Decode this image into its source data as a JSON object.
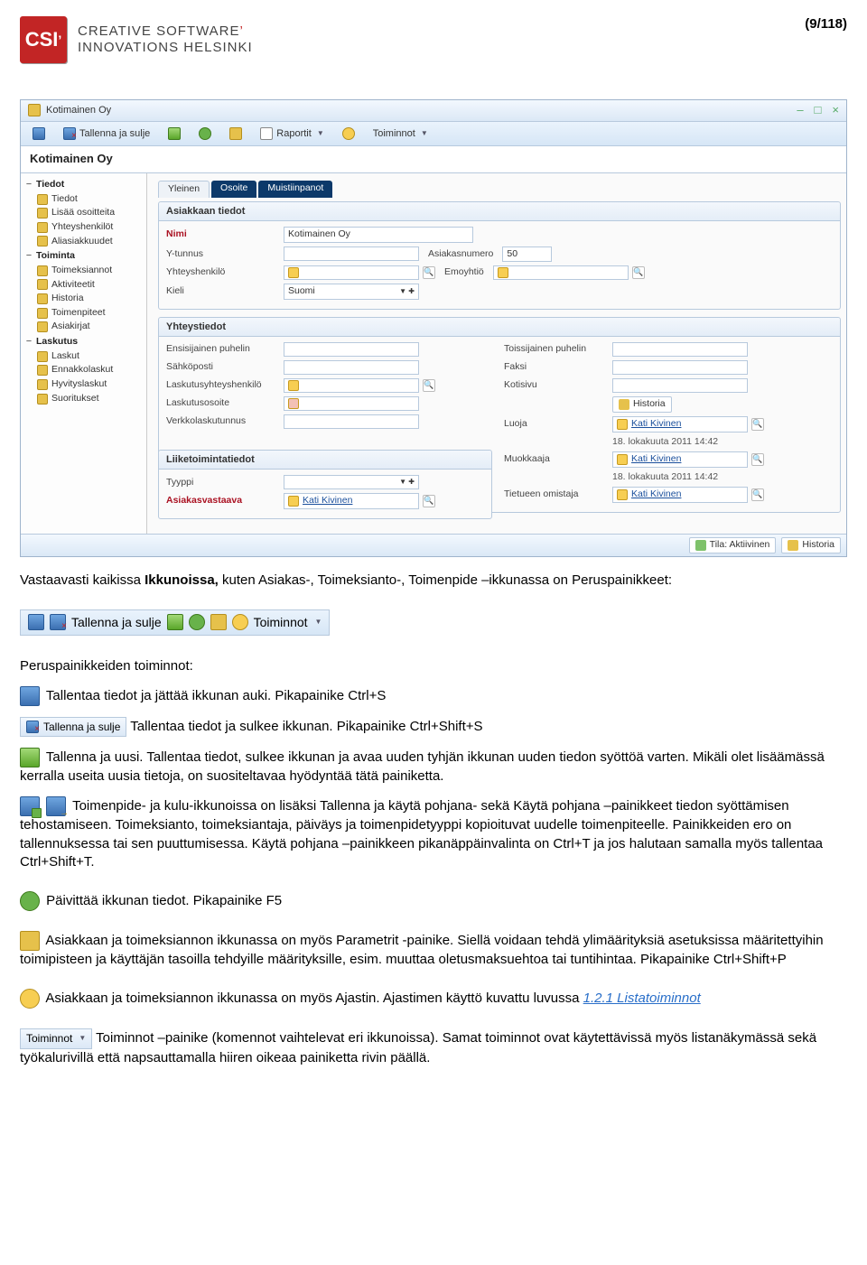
{
  "header": {
    "logo_mark": "CSI",
    "logo_line1": "CREATIVE SOFTWARE",
    "logo_line2": "INNOVATIONS HELSINKI",
    "page_indicator": "(9/118)"
  },
  "window": {
    "title": "Kotimainen Oy",
    "win_min": "–",
    "win_max": "□",
    "win_close": "×",
    "toolbar": {
      "save_close": "Tallenna ja sulje",
      "reports": "Raportit",
      "actions": "Toiminnot"
    },
    "subheader": "Kotimainen Oy",
    "tree": {
      "cat1": {
        "title": "Tiedot",
        "items": [
          "Tiedot",
          "Lisää osoitteita",
          "Yhteyshenkilöt",
          "Aliasiakkuudet"
        ]
      },
      "cat2": {
        "title": "Toiminta",
        "items": [
          "Toimeksiannot",
          "Aktiviteetit",
          "Historia",
          "Toimenpiteet",
          "Asiakirjat"
        ]
      },
      "cat3": {
        "title": "Laskutus",
        "items": [
          "Laskut",
          "Ennakkolaskut",
          "Hyvityslaskut",
          "Suoritukset"
        ]
      }
    },
    "tabs": {
      "t1": "Yleinen",
      "t2": "Osoite",
      "t3": "Muistiinpanot"
    },
    "panel1": {
      "title": "Asiakkaan tiedot",
      "name_label": "Nimi",
      "name_value": "Kotimainen Oy",
      "ytunnus_label": "Y-tunnus",
      "custno_label": "Asiakasnumero",
      "custno_value": "50",
      "contact_label": "Yhteyshenkilö",
      "parent_label": "Emoyhtiö",
      "lang_label": "Kieli",
      "lang_value": "Suomi"
    },
    "panel2": {
      "title": "Yhteystiedot",
      "phone1_label": "Ensisijainen puhelin",
      "phone2_label": "Toissijainen puhelin",
      "email_label": "Sähköposti",
      "fax_label": "Faksi",
      "billcontact_label": "Laskutusyhteyshenkilö",
      "website_label": "Kotisivu",
      "billaddr_label": "Laskutusosoite",
      "history_btn": "Historia",
      "einvoice_label": "Verkkolaskutunnus",
      "creator_label": "Luoja",
      "creator_value": "Kati Kivinen",
      "created_at": "18. lokakuuta 2011 14:42",
      "modifier_label": "Muokkaaja",
      "modifier_value": "Kati Kivinen",
      "modified_at": "18. lokakuuta 2011 14:42",
      "owner_label": "Tietueen omistaja",
      "owner_value": "Kati Kivinen"
    },
    "panel3": {
      "title": "Liiketoimintatiedot",
      "type_label": "Tyyppi",
      "resp_label": "Asiakasvastaava",
      "resp_value": "Kati Kivinen"
    },
    "status": {
      "active_label": "Tila: Aktiivinen",
      "history_label": "Historia"
    }
  },
  "doc": {
    "intro1a": "Vastaavasti kaikissa ",
    "intro1b": "Ikkunoissa,",
    "intro1c": " kuten Asiakas-, Toimeksianto-, Toimenpide –ikkunassa on Peruspainikkeet:",
    "funcs_heading": "Peruspainikkeiden toiminnot:",
    "p_save": " Tallentaa tiedot ja jättää ikkunan auki. Pikapainike Ctrl+S",
    "p_saveclose_btn": "Tallenna ja sulje",
    "p_saveclose": " Tallentaa tiedot ja sulkee ikkunan. Pikapainike Ctrl+Shift+S",
    "p_new": " Tallenna ja uusi. Tallentaa tiedot, sulkee ikkunan ja avaa uuden tyhjän ikkunan uuden tiedon syöttöä varten. Mikäli olet lisäämässä kerralla useita uusia tietoja, on suositeltavaa hyödyntää tätä painiketta.",
    "p_template": " Toimenpide- ja kulu-ikkunoissa on lisäksi Tallenna ja käytä pohjana- sekä Käytä pohjana –painikkeet tiedon syöttämisen tehostamiseen. Toimeksianto, toimeksiantaja, päiväys ja toimenpidetyyppi kopioituvat uudelle toimenpiteelle. Painikkeiden ero on tallennuksessa tai sen puuttumisessa. Käytä pohjana –painikkeen pikanäppäinvalinta on Ctrl+T ja jos halutaan samalla myös tallentaa Ctrl+Shift+T.",
    "p_refresh": " Päivittää ikkunan tiedot. Pikapainike F5",
    "p_params": " Asiakkaan ja toimeksiannon ikkunassa on myös Parametrit -painike. Siellä voidaan tehdä ylimäärityksiä asetuksissa määritettyihin toimipisteen ja käyttäjän tasoilla tehdyille määrityksille, esim. muuttaa oletusmaksuehtoa tai tuntihintaa. Pikapainike Ctrl+Shift+P",
    "p_timer_a": " Asiakkaan ja toimeksiannon ikkunassa on myös Ajastin. Ajastimen käyttö kuvattu luvussa ",
    "p_timer_link": "1.2.1 Listatoiminnot",
    "p_actions_btn": "Toiminnot",
    "p_actions": " Toiminnot –painike (komennot vaihtelevat eri ikkunoissa). Samat toiminnot ovat käytettävissä myös listanäkymässä sekä työkalurivillä että napsauttamalla hiiren oikeaa painiketta rivin päällä.",
    "strip_saveclose": "Tallenna ja sulje",
    "strip_actions": "Toiminnot"
  }
}
